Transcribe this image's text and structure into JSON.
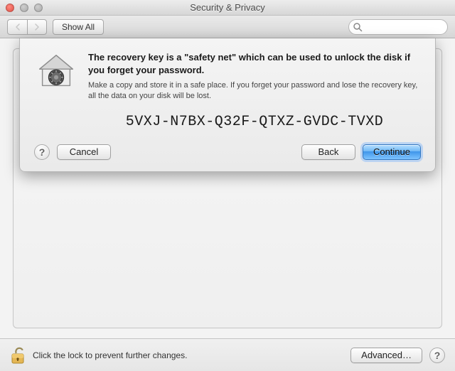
{
  "window": {
    "title": "Security & Privacy"
  },
  "toolbar": {
    "show_all_label": "Show All",
    "search_placeholder": ""
  },
  "dialog": {
    "heading": "The recovery key is a \"safety net\" which can be used to unlock the disk if you forget your password.",
    "subtext": "Make a copy and store it in a safe place. If you forget your password and lose the recovery key, all the data on your disk will be lost.",
    "recovery_key": "5VXJ-N7BX-Q32F-QTXZ-GVDC-TVXD",
    "cancel_label": "Cancel",
    "back_label": "Back",
    "continue_label": "Continue"
  },
  "footer": {
    "lock_text": "Click the lock to prevent further changes.",
    "advanced_label": "Advanced…"
  }
}
